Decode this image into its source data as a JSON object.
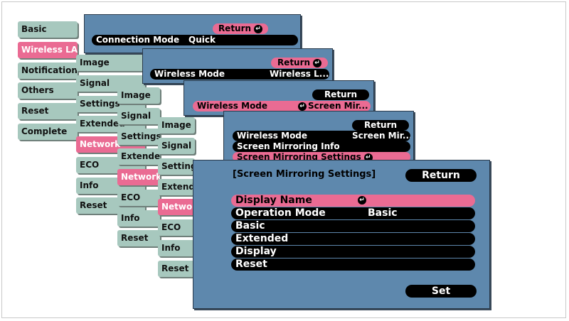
{
  "icons": {
    "enter": "↵"
  },
  "colors": {
    "panel": "#5e88ad",
    "highlight": "#ea6b93",
    "sidebar": "#a7c8be"
  },
  "menu1": {
    "sidebar": [
      "Basic",
      "Wireless LAN",
      "Notifications",
      "Others",
      "Reset",
      "Complete"
    ],
    "return_label": "Return",
    "connection_mode_label": "Connection Mode",
    "connection_mode_value": "Quick"
  },
  "menu2": {
    "sidebar": [
      "Image",
      "Signal",
      "Settings",
      "Extended",
      "Network",
      "ECO",
      "Info",
      "Reset"
    ],
    "return_label": "Return",
    "wireless_mode_label": "Wireless Mode",
    "wireless_mode_value": "Wireless L..."
  },
  "menu3": {
    "sidebar": [
      "Image",
      "Signal",
      "Settings",
      "Extended",
      "Network",
      "ECO",
      "Info",
      "Reset"
    ],
    "return_label": "Return",
    "wireless_mode_label": "Wireless Mode",
    "wireless_mode_value": "Screen Mir..."
  },
  "menu4": {
    "sidebar": [
      "Image",
      "Signal",
      "Setting",
      "Extende",
      "Network",
      "ECO",
      "Info",
      "Reset"
    ],
    "return_label": "Return",
    "rows": [
      {
        "label": "Wireless Mode",
        "value": "Screen Mir..."
      },
      {
        "label": "Screen Mirroring Info",
        "value": ""
      },
      {
        "label": "Screen Mirroring Settings",
        "value": ""
      }
    ]
  },
  "front": {
    "title": "[Screen Mirroring Settings]",
    "return_label": "Return",
    "rows": [
      {
        "label": "Display Name",
        "value": ""
      },
      {
        "label": "Operation Mode",
        "value": "Basic"
      },
      {
        "label": "Basic",
        "value": ""
      },
      {
        "label": "Extended",
        "value": ""
      },
      {
        "label": "Display",
        "value": ""
      },
      {
        "label": "Reset",
        "value": ""
      }
    ],
    "set_label": "Set"
  }
}
